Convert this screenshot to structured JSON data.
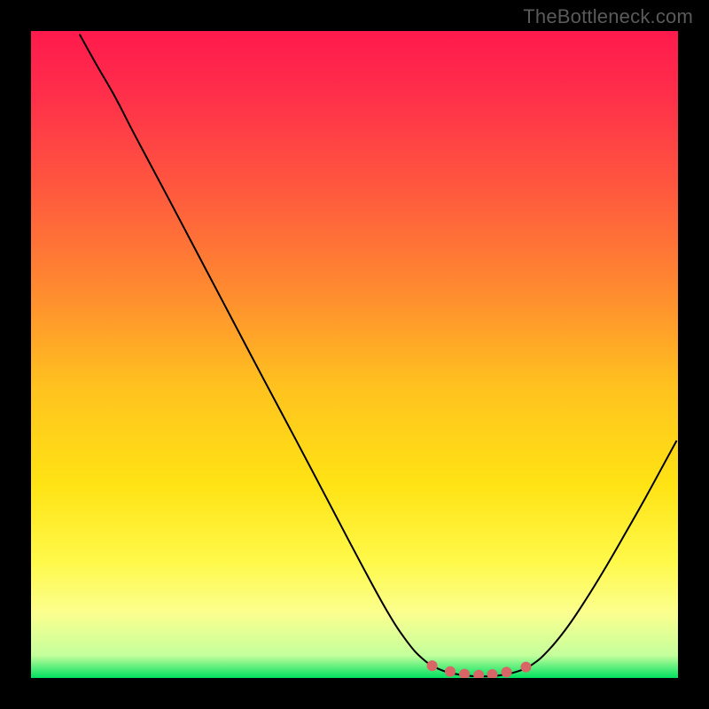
{
  "watermark": "TheBottleneck.com",
  "chart_data": {
    "type": "line",
    "title": "",
    "xlabel": "",
    "ylabel": "",
    "xlim": [
      0,
      100
    ],
    "ylim": [
      0,
      100
    ],
    "background_gradient": {
      "stops": [
        {
          "offset": 0.0,
          "color": "#ff1a4d"
        },
        {
          "offset": 0.1,
          "color": "#ff2f4a"
        },
        {
          "offset": 0.25,
          "color": "#ff5a3e"
        },
        {
          "offset": 0.4,
          "color": "#ff8a30"
        },
        {
          "offset": 0.55,
          "color": "#ffc21f"
        },
        {
          "offset": 0.7,
          "color": "#ffe314"
        },
        {
          "offset": 0.82,
          "color": "#fff94a"
        },
        {
          "offset": 0.9,
          "color": "#fbff8f"
        },
        {
          "offset": 0.965,
          "color": "#c4ff9c"
        },
        {
          "offset": 1.0,
          "color": "#00e060"
        }
      ]
    },
    "series": [
      {
        "name": "bottleneck-curve",
        "color": "#000000",
        "stroke_width": 2,
        "points": [
          {
            "x": 7.5,
            "y": 99.5
          },
          {
            "x": 10.0,
            "y": 95.0
          },
          {
            "x": 13.0,
            "y": 89.8
          },
          {
            "x": 16.0,
            "y": 84.0
          },
          {
            "x": 21.0,
            "y": 74.6
          },
          {
            "x": 26.0,
            "y": 65.1
          },
          {
            "x": 31.0,
            "y": 55.6
          },
          {
            "x": 36.0,
            "y": 46.1
          },
          {
            "x": 41.0,
            "y": 36.7
          },
          {
            "x": 46.0,
            "y": 27.2
          },
          {
            "x": 51.0,
            "y": 17.7
          },
          {
            "x": 55.0,
            "y": 10.4
          },
          {
            "x": 58.0,
            "y": 5.8
          },
          {
            "x": 60.5,
            "y": 3.0
          },
          {
            "x": 63.0,
            "y": 1.4
          },
          {
            "x": 66.0,
            "y": 0.55
          },
          {
            "x": 69.0,
            "y": 0.25
          },
          {
            "x": 72.0,
            "y": 0.35
          },
          {
            "x": 75.0,
            "y": 0.95
          },
          {
            "x": 77.5,
            "y": 2.1
          },
          {
            "x": 80.0,
            "y": 4.3
          },
          {
            "x": 83.0,
            "y": 8.0
          },
          {
            "x": 86.0,
            "y": 12.5
          },
          {
            "x": 89.0,
            "y": 17.4
          },
          {
            "x": 92.0,
            "y": 22.6
          },
          {
            "x": 95.0,
            "y": 27.9
          },
          {
            "x": 98.0,
            "y": 33.4
          },
          {
            "x": 99.8,
            "y": 36.7
          }
        ]
      }
    ],
    "markers": {
      "name": "bottom-dot-markers",
      "color": "#d96666",
      "radius_outer": 6,
      "points": [
        {
          "x": 62.0,
          "y": 1.9
        },
        {
          "x": 64.8,
          "y": 1.0
        },
        {
          "x": 67.0,
          "y": 0.6
        },
        {
          "x": 69.2,
          "y": 0.45
        },
        {
          "x": 71.3,
          "y": 0.55
        },
        {
          "x": 73.5,
          "y": 0.9
        },
        {
          "x": 76.5,
          "y": 1.7
        }
      ]
    }
  }
}
